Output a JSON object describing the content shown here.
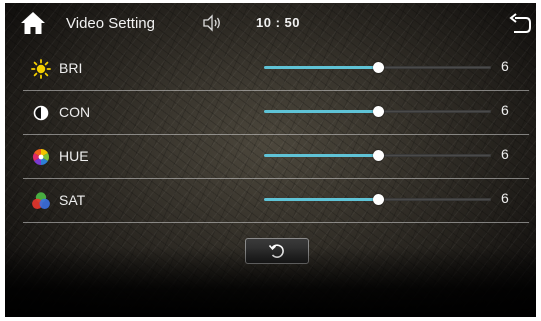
{
  "header": {
    "title": "Video Setting",
    "clock": "10 : 50",
    "icons": [
      "home-icon",
      "volume-icon",
      "back-icon"
    ]
  },
  "settings": [
    {
      "label": "BRI",
      "value": "6",
      "level": 0.5,
      "icon": "sun-icon"
    },
    {
      "label": "CON",
      "value": "6",
      "level": 0.5,
      "icon": "contrast-icon"
    },
    {
      "label": "HUE",
      "value": "6",
      "level": 0.5,
      "icon": "color-wheel-icon"
    },
    {
      "label": "SAT",
      "value": "6",
      "level": 0.5,
      "icon": "saturation-icon"
    }
  ],
  "reset": {
    "icon": "reset-icon"
  },
  "colors": {
    "accent": "#5fc3d6",
    "text": "#eeeeee"
  }
}
